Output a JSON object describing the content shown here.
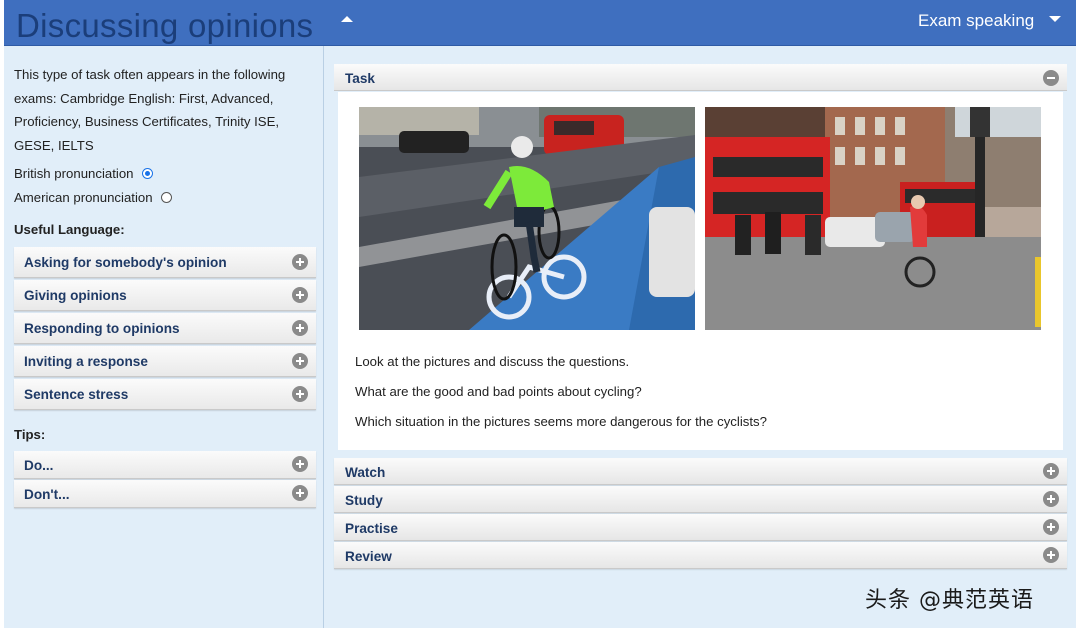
{
  "header": {
    "title": "Discussing opinions",
    "exam_menu_label": "Exam speaking"
  },
  "sidebar": {
    "intro": "This type of task often appears in the following exams: Cambridge English: First, Advanced, Proficiency, Business Certificates, Trinity ISE, GESE, IELTS",
    "pronunciation": {
      "british": "British pronunciation",
      "american": "American pronunciation",
      "selected": "british"
    },
    "useful_language_label": "Useful Language:",
    "useful_language": [
      {
        "label": "Asking for somebody's opinion"
      },
      {
        "label": "Giving opinions"
      },
      {
        "label": "Responding to opinions"
      },
      {
        "label": "Inviting a response"
      },
      {
        "label": "Sentence stress"
      }
    ],
    "tips_label": "Tips:",
    "tips": [
      {
        "label": "Do..."
      },
      {
        "label": "Don't..."
      }
    ]
  },
  "main": {
    "task": {
      "label": "Task",
      "images": [
        "cyclist in green jacket on blue cycle lane",
        "cyclists among red buses on a London street"
      ],
      "questions": [
        "Look at the pictures and discuss the questions.",
        "What are the good and bad points about cycling?",
        "Which situation in the pictures seems more dangerous for the cyclists?"
      ]
    },
    "sections": [
      {
        "label": "Watch"
      },
      {
        "label": "Study"
      },
      {
        "label": "Practise"
      },
      {
        "label": "Review"
      }
    ]
  },
  "watermark": "头条 @典范英语",
  "colors": {
    "header_bg": "#3f6fbf",
    "title_text": "#1b3e7a",
    "page_bg": "#e1eef9",
    "accordion_text": "#1f3a66",
    "radio_selected": "#1a73e8"
  }
}
